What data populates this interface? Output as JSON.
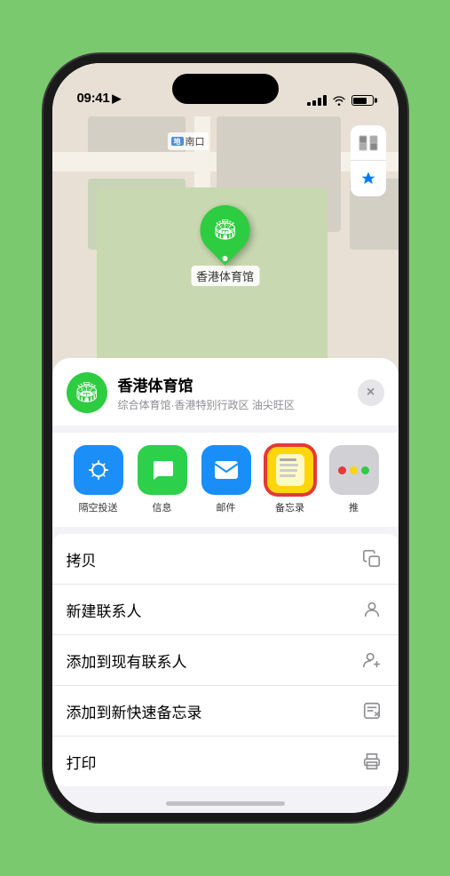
{
  "status_bar": {
    "time": "09:41",
    "navigation_arrow": "▶"
  },
  "map": {
    "label_text": "南口",
    "map_icon": "地"
  },
  "map_controls": {
    "map_btn": "🗺",
    "location_btn": "⇗"
  },
  "venue_pin": {
    "label": "香港体育馆",
    "icon": "🏟"
  },
  "sheet": {
    "venue_name": "香港体育馆",
    "venue_subtitle": "综合体育馆·香港特别行政区 油尖旺区",
    "close_label": "×"
  },
  "share_items": [
    {
      "label": "隔空投送",
      "type": "airdrop"
    },
    {
      "label": "信息",
      "type": "messages"
    },
    {
      "label": "邮件",
      "type": "mail"
    },
    {
      "label": "备忘录",
      "type": "notes",
      "highlighted": true
    },
    {
      "label": "推",
      "type": "more"
    }
  ],
  "actions": [
    {
      "label": "拷贝",
      "icon": "copy"
    },
    {
      "label": "新建联系人",
      "icon": "person"
    },
    {
      "label": "添加到现有联系人",
      "icon": "person-add"
    },
    {
      "label": "添加到新快速备忘录",
      "icon": "note"
    },
    {
      "label": "打印",
      "icon": "print"
    }
  ]
}
